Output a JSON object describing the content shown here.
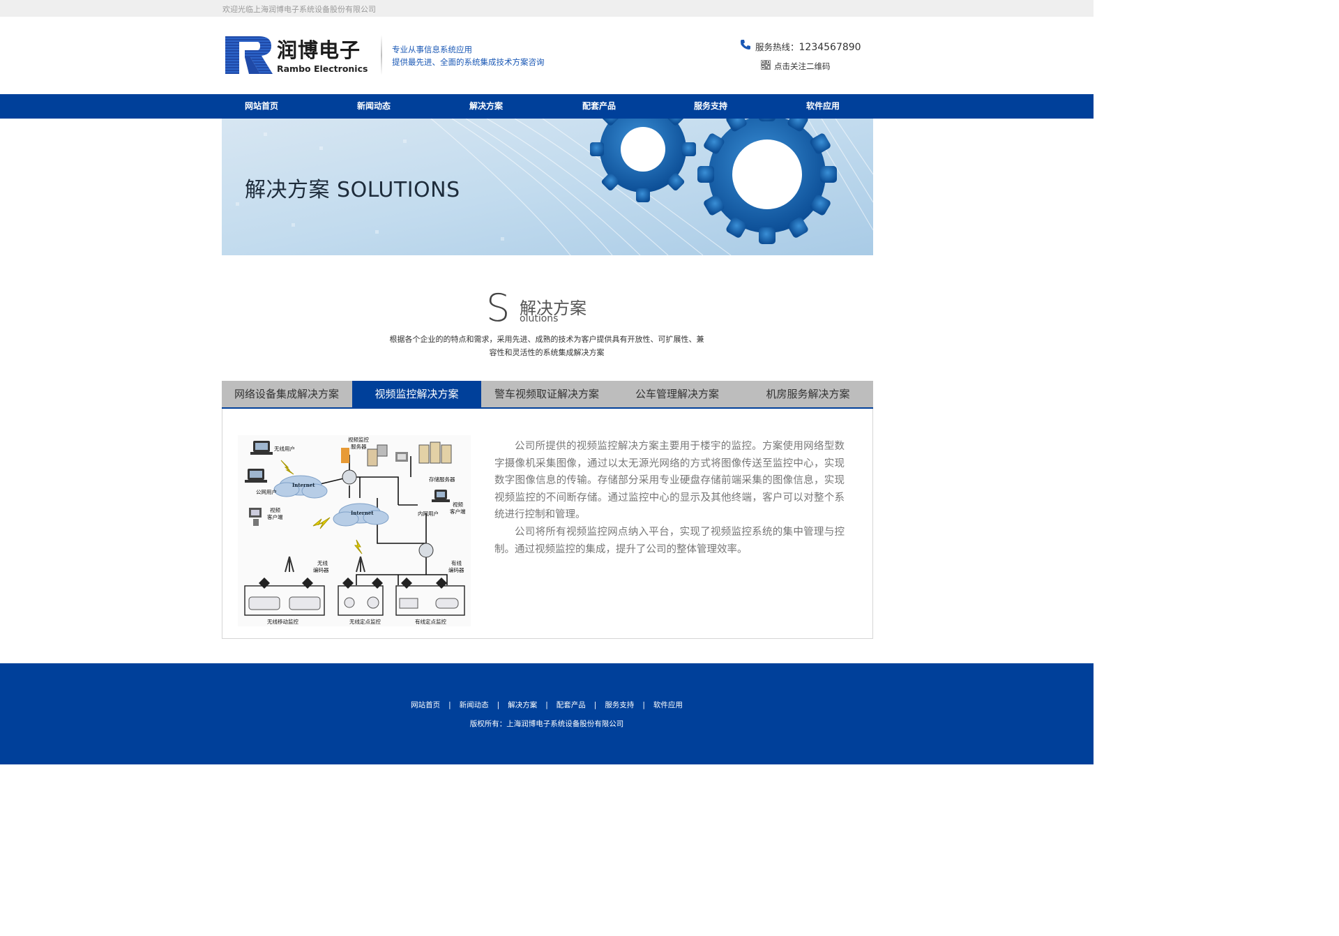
{
  "topbar": {
    "welcome": "欢迎光临上海润博电子系统设备股份有限公司"
  },
  "header": {
    "logo_cn": "润博电子",
    "logo_en": "Rambo Electronics",
    "slogan_line1": "专业从事信息系统应用",
    "slogan_line2": "提供最先进、全面的系统集成技术方案咨询",
    "hotline_label": "服务热线：",
    "hotline_number": "1234567890",
    "qr_text": "点击关注二维码",
    "phone_icon": "phone-icon",
    "qr_icon": "qr-code-icon"
  },
  "nav": {
    "items": [
      {
        "label": "网站首页"
      },
      {
        "label": "新闻动态"
      },
      {
        "label": "解决方案"
      },
      {
        "label": "配套产品"
      },
      {
        "label": "服务支持"
      },
      {
        "label": "软件应用"
      }
    ]
  },
  "banner": {
    "title": "解决方案 SOLUTIONS"
  },
  "section": {
    "letter": "S",
    "title_cn": "解决方案",
    "title_en": "olutions",
    "desc_line1": "根据各个企业的的特点和需求，采用先进、成熟的技术为客户提供具有开放性、可扩展性、兼",
    "desc_line2": "容性和灵活性的系统集成解决方案"
  },
  "tabs": [
    {
      "label": "网络设备集成解决方案",
      "active": false
    },
    {
      "label": "视频监控解决方案",
      "active": true
    },
    {
      "label": "警车视频取证解决方案",
      "active": false
    },
    {
      "label": "公车管理解决方案",
      "active": false
    },
    {
      "label": "机房服务解决方案",
      "active": false
    }
  ],
  "content": {
    "paragraph1": "公司所提供的视频监控解决方案主要用于楼宇的监控。方案使用网络型数字摄像机采集图像，通过以太无源光网络的方式将图像传送至监控中心，实现数字图像信息的传输。存储部分采用专业硬盘存储前端采集的图像信息，实现视频监控的不间断存储。通过监控中心的显示及其他终端，客户可以对整个系统进行控制和管理。",
    "paragraph2": "公司将所有视频监控网点纳入平台，实现了视频监控系统的集中管理与控制。通过视频监控的集成，提升了公司的整体管理效率。",
    "diagram": {
      "wireless_user": "无线用户",
      "video_server": "视频监控服务器",
      "video_server_l1": "视频监控",
      "video_server_l2": "服务器",
      "internet": "Internet",
      "storage_server": "存储服务器",
      "public_user": "公网用户",
      "video_client_l1": "视频",
      "video_client_l2": "客户端",
      "lan_user": "内网用户",
      "wireless_encoder_l1": "无线",
      "wireless_encoder_l2": "编码器",
      "wired_encoder_l1": "有线",
      "wired_encoder_l2": "编码器",
      "wireless_mobile": "无线移动监控",
      "wireless_fixed": "无线定点监控",
      "wired_fixed": "有线定点监控"
    }
  },
  "footer": {
    "links": [
      {
        "label": "网站首页"
      },
      {
        "label": "新闻动态"
      },
      {
        "label": "解决方案"
      },
      {
        "label": "配套产品"
      },
      {
        "label": "服务支持"
      },
      {
        "label": "软件应用"
      }
    ],
    "separator": "|",
    "copyright": "版权所有：上海润博电子系统设备股份有限公司"
  },
  "colors": {
    "brand_blue": "#00409a",
    "slogan_blue": "#1a58b5",
    "tab_gray": "#bdbdbd"
  }
}
